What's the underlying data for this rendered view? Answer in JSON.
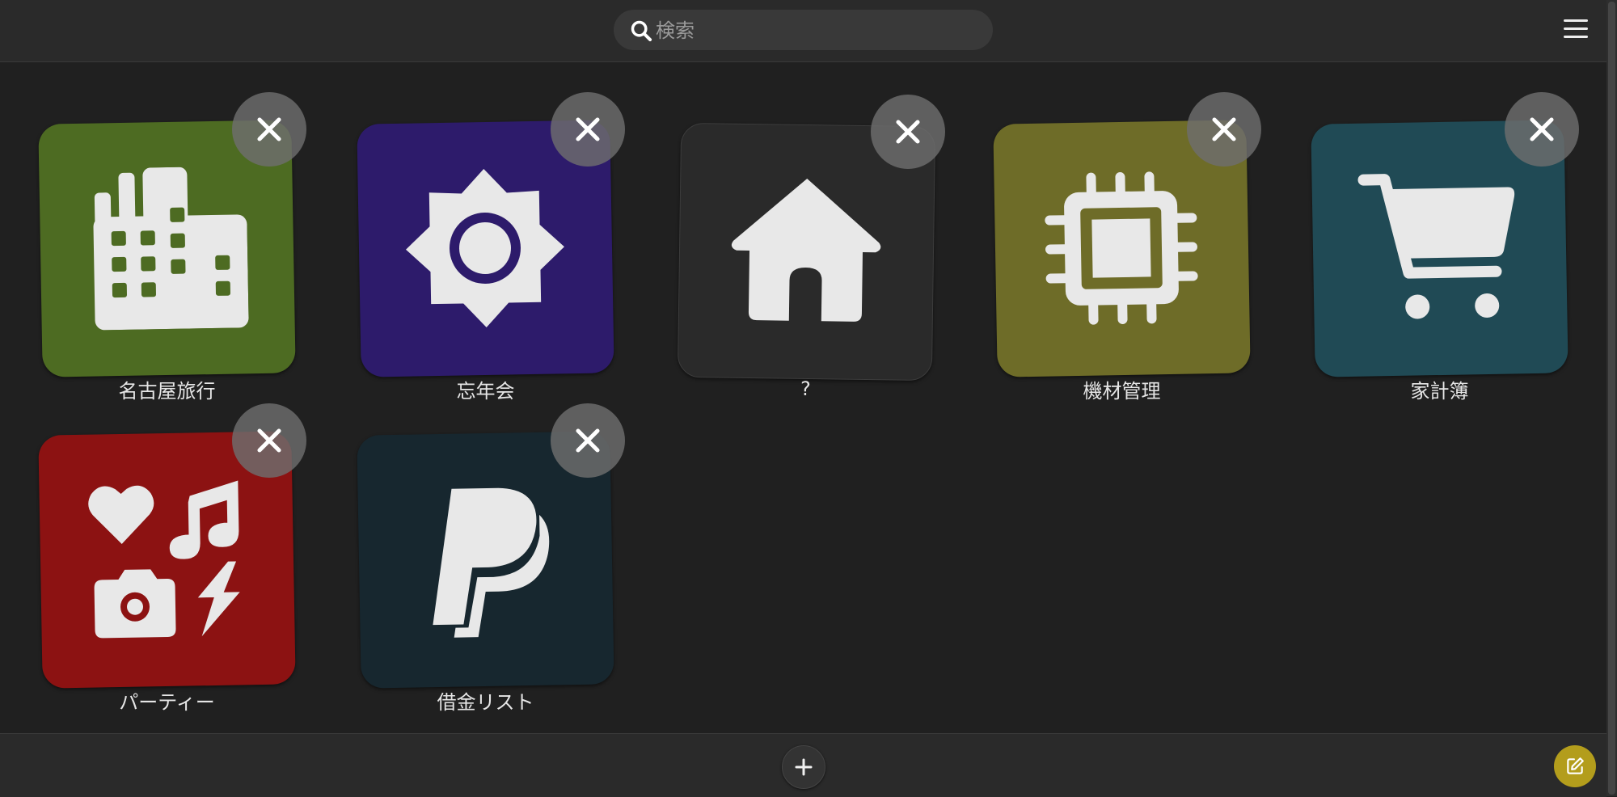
{
  "search": {
    "placeholder": "検索",
    "value": ""
  },
  "tiles": [
    {
      "label": "名古屋旅行",
      "icon": "city-buildings-icon",
      "color": "#4d6b22"
    },
    {
      "label": "忘年会",
      "icon": "sun-icon",
      "color": "#2d1b6b"
    },
    {
      "label": "?",
      "icon": "home-icon",
      "color": "#2a2a2a"
    },
    {
      "label": "機材管理",
      "icon": "cpu-chip-icon",
      "color": "#6e6c28"
    },
    {
      "label": "家計簿",
      "icon": "shopping-cart-icon",
      "color": "#204a55"
    },
    {
      "label": "パーティー",
      "icon": "party-icons-icon",
      "color": "#8c1212"
    },
    {
      "label": "借金リスト",
      "icon": "paypal-icon",
      "color": "#17272f"
    }
  ],
  "colors": {
    "background": "#202020",
    "bar": "#2a2a2a",
    "edit_accent": "#b39d1c",
    "close": "#6e6e6e"
  }
}
